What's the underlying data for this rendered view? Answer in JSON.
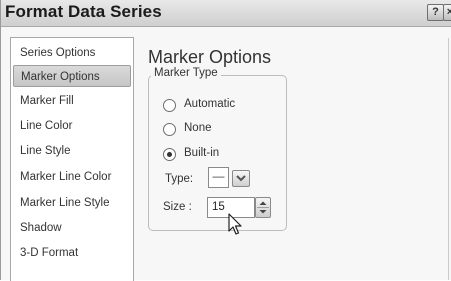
{
  "window": {
    "title": "Format Data Series",
    "help_glyph": "?",
    "close_glyph": "×"
  },
  "nav": {
    "items": [
      {
        "label": "Series Options",
        "selected": false
      },
      {
        "label": "Marker Options",
        "selected": true
      },
      {
        "label": "Marker Fill",
        "selected": false
      },
      {
        "label": "Line Color",
        "selected": false
      },
      {
        "label": "Line Style",
        "selected": false
      },
      {
        "label": "Marker Line Color",
        "selected": false
      },
      {
        "label": "Marker Line Style",
        "selected": false
      },
      {
        "label": "Shadow",
        "selected": false
      },
      {
        "label": "3-D Format",
        "selected": false
      }
    ]
  },
  "main": {
    "section_title": "Marker Options",
    "marker_type": {
      "legend": "Marker Type",
      "options": [
        {
          "label": "Automatic",
          "checked": false
        },
        {
          "label": "None",
          "checked": false
        },
        {
          "label": "Built-in",
          "checked": true
        }
      ],
      "type_label": "Type:",
      "type_value": "—",
      "size_label": "Size :",
      "size_value": "15"
    }
  },
  "icons": {
    "dropdown": "chevron-down-icon",
    "spinner": "spinner-up-down-icon",
    "cursor": "mouse-pointer-icon"
  }
}
